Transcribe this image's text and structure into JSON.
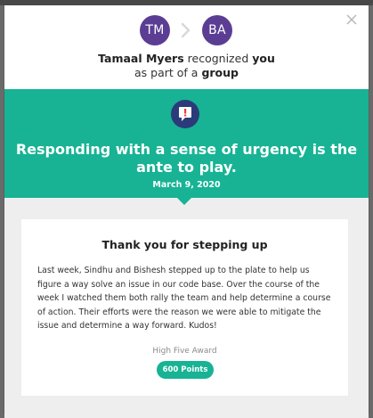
{
  "header": {
    "sender_initials": "TM",
    "recipient_initials": "BA",
    "sender_name": "Tamaal Myers",
    "recognized_word": "recognized",
    "you_word": "you",
    "as_part_of": "as part of a",
    "group_word": "group"
  },
  "banner": {
    "badge_icon": "exclamation-icon",
    "headline": "Responding with a sense of urgency is the ante to play.",
    "date": "March 9, 2020"
  },
  "card": {
    "title": "Thank you for stepping up",
    "body": "Last week, Sindhu and Bishesh stepped up to the plate to help us figure a way solve an issue in our code base. Over the course of the week I watched them both rally the team and help determine a course of action. Their efforts were the reason we were able to mitigate the issue and determine a way forward. Kudos!",
    "award_label": "High Five Award",
    "points": "600 Points"
  },
  "colors": {
    "accent": "#17b394",
    "avatar": "#5b3e94",
    "badge": "#2b3b7a"
  }
}
